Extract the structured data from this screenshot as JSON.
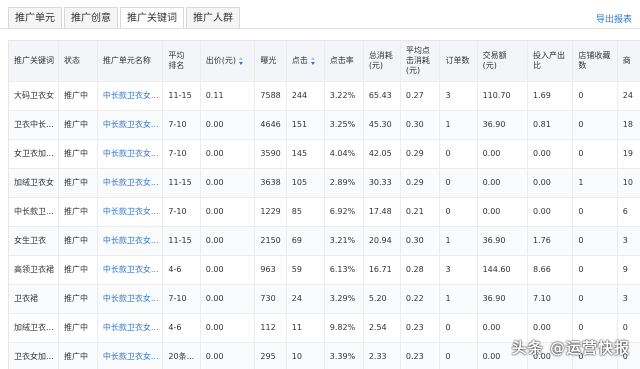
{
  "tabs": [
    "推广单元",
    "推广创意",
    "推广关键词",
    "推广人群"
  ],
  "active_tab": "推广关键词",
  "export_label": "导出报表",
  "columns": [
    "推广关键词",
    "状态",
    "推广单元名称",
    "平均排名",
    "出价(元)",
    "曝光",
    "点击",
    "点击率",
    "总消耗(元)",
    "平均点击消耗(元)",
    "订单数",
    "交易额(元)",
    "投入产出比",
    "店铺收藏数",
    "商"
  ],
  "rows": [
    [
      "大码卫衣女",
      "推广中",
      "中长款卫衣女...",
      "11-15",
      "0.11",
      "7588",
      "244",
      "3.22%",
      "65.43",
      "0.27",
      "3",
      "110.70",
      "1.69",
      "0",
      "24"
    ],
    [
      "卫衣中长...",
      "推广中",
      "中长款卫衣女...",
      "7-10",
      "0.00",
      "4646",
      "151",
      "3.25%",
      "45.30",
      "0.30",
      "1",
      "36.90",
      "0.81",
      "0",
      "18"
    ],
    [
      "女卫衣加...",
      "推广中",
      "中长款卫衣女...",
      "7-10",
      "0.00",
      "3590",
      "145",
      "4.04%",
      "42.05",
      "0.29",
      "0",
      "0.00",
      "0.00",
      "0",
      "19"
    ],
    [
      "加绒卫衣女",
      "推广中",
      "中长款卫衣女...",
      "11-15",
      "0.00",
      "3638",
      "105",
      "2.89%",
      "30.33",
      "0.29",
      "0",
      "0.00",
      "0.00",
      "1",
      "10"
    ],
    [
      "中长款卫...",
      "推广中",
      "中长款卫衣女...",
      "7-10",
      "0.00",
      "1229",
      "85",
      "6.92%",
      "17.48",
      "0.21",
      "0",
      "0.00",
      "0.00",
      "0",
      "6"
    ],
    [
      "女生卫衣",
      "推广中",
      "中长款卫衣女...",
      "11-15",
      "0.00",
      "2150",
      "69",
      "3.21%",
      "20.94",
      "0.30",
      "1",
      "36.90",
      "1.76",
      "0",
      "3"
    ],
    [
      "高领卫衣裙",
      "推广中",
      "中长款卫衣女...",
      "4-6",
      "0.00",
      "963",
      "59",
      "6.13%",
      "16.71",
      "0.28",
      "3",
      "144.60",
      "8.66",
      "0",
      "9"
    ],
    [
      "卫衣裙",
      "推广中",
      "中长款卫衣女...",
      "7-10",
      "0.00",
      "730",
      "24",
      "3.29%",
      "5.20",
      "0.22",
      "1",
      "36.90",
      "7.10",
      "0",
      "3"
    ],
    [
      "加绒卫衣...",
      "推广中",
      "中长款卫衣女...",
      "4-6",
      "0.00",
      "112",
      "11",
      "9.82%",
      "2.54",
      "0.23",
      "0",
      "0.00",
      "0.00",
      "0",
      "0"
    ],
    [
      "卫衣女加...",
      "推广中",
      "中长款卫衣女...",
      "20条...",
      "0.00",
      "295",
      "10",
      "3.39%",
      "2.33",
      "0.23",
      "0",
      "0.00",
      "0.00",
      "0",
      "0"
    ]
  ],
  "watermark": "头条 @运营快报"
}
